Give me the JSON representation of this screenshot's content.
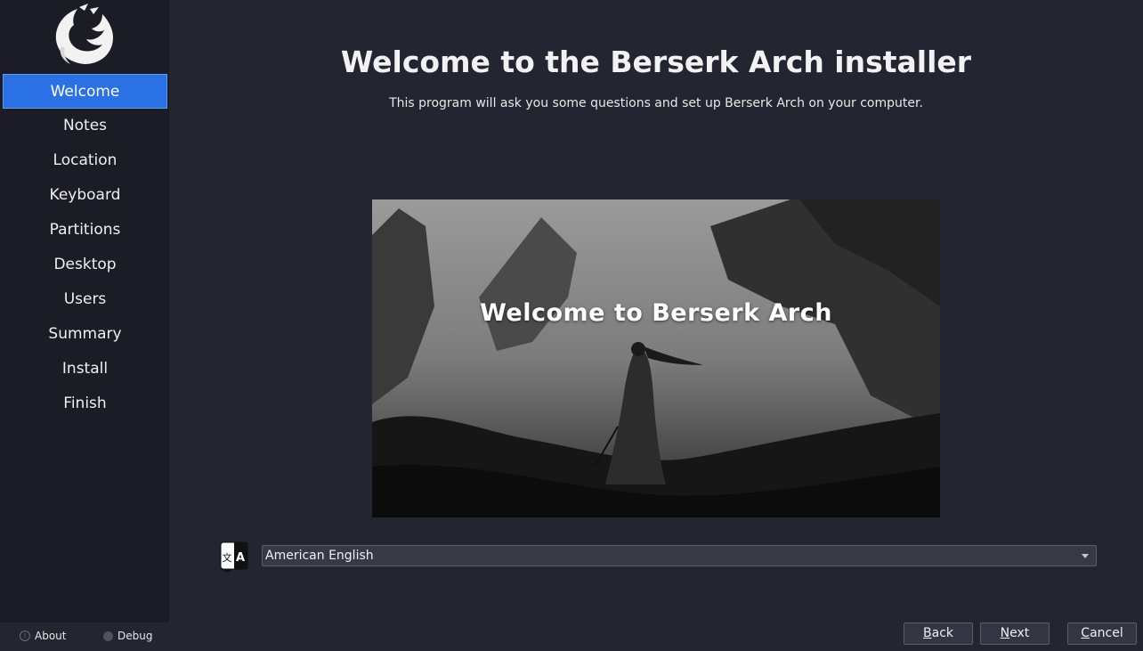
{
  "sidebar": {
    "steps": [
      {
        "label": "Welcome",
        "active": true
      },
      {
        "label": "Notes"
      },
      {
        "label": "Location"
      },
      {
        "label": "Keyboard"
      },
      {
        "label": "Partitions"
      },
      {
        "label": "Desktop"
      },
      {
        "label": "Users"
      },
      {
        "label": "Summary"
      },
      {
        "label": "Install"
      },
      {
        "label": "Finish"
      }
    ],
    "about_label": "About",
    "debug_label": "Debug"
  },
  "main": {
    "title": "Welcome to the Berserk Arch installer",
    "subtitle": "This program will ask you some questions and set up Berserk Arch on your computer.",
    "banner_caption": "Welcome to Berserk Arch",
    "language": {
      "selected": "American English"
    }
  },
  "buttons": {
    "back": {
      "mnemonic": "B",
      "rest": "ack"
    },
    "next": {
      "mnemonic": "N",
      "rest": "ext"
    },
    "cancel": {
      "mnemonic": "C",
      "rest": "ancel"
    }
  },
  "colors": {
    "accent": "#2a71e6",
    "background": "#232530",
    "sidebar": "#1b1c26"
  }
}
